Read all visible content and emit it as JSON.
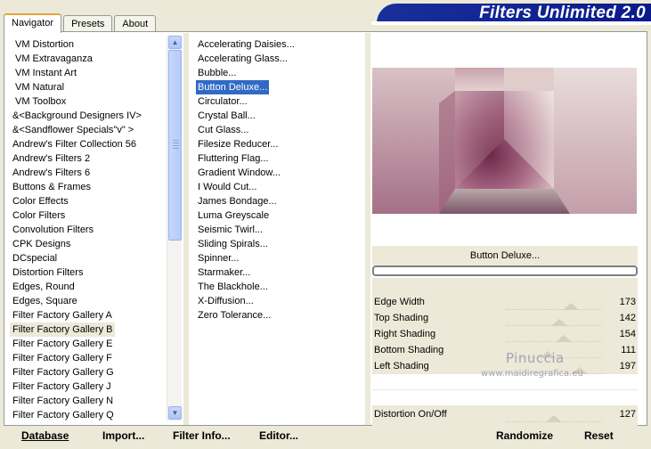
{
  "tabs": [
    "Navigator",
    "Presets",
    "About"
  ],
  "brand_title": "Filters Unlimited 2.0",
  "categories": [
    "VM Distortion",
    "VM Extravaganza",
    "VM Instant Art",
    "VM Natural",
    "VM Toolbox",
    "&<Background Designers IV>",
    "&<Sandflower Specials\"v\" >",
    "Andrew's Filter Collection 56",
    "Andrew's Filters 2",
    "Andrew's Filters 6",
    "Buttons & Frames",
    "Color Effects",
    "Color Filters",
    "Convolution Filters",
    "CPK Designs",
    "DCspecial",
    "Distortion Filters",
    "Edges, Round",
    "Edges, Square",
    "Filter Factory Gallery A",
    "Filter Factory Gallery B",
    "Filter Factory Gallery E",
    "Filter Factory Gallery F",
    "Filter Factory Gallery G",
    "Filter Factory Gallery J",
    "Filter Factory Gallery N",
    "Filter Factory Gallery Q"
  ],
  "selected_category": "Filter Factory Gallery B",
  "filters": [
    "Accelerating Daisies...",
    "Accelerating Glass...",
    "Bubble...",
    "Button Deluxe...",
    "Circulator...",
    "Crystal Ball...",
    "Cut Glass...",
    "Filesize Reducer...",
    "Fluttering Flag...",
    "Gradient Window...",
    "I Would Cut...",
    "James Bondage...",
    "Luma Greyscale",
    "Seismic Twirl...",
    "Sliding Spirals...",
    "Spinner...",
    "Starmaker...",
    "The Blackhole...",
    "X-Diffusion...",
    "Zero Tolerance..."
  ],
  "selected_filter": "Button Deluxe...",
  "filter_name": "Button Deluxe...",
  "progress": 0,
  "sliders": [
    {
      "label": "Edge Width",
      "value": "173",
      "max": 255
    },
    {
      "label": "Top Shading",
      "value": "142",
      "max": 255
    },
    {
      "label": "Right Shading",
      "value": "154",
      "max": 255
    },
    {
      "label": "Bottom Shading",
      "value": "111",
      "max": 255
    },
    {
      "label": "Left Shading",
      "value": "197",
      "max": 255
    },
    {
      "label": "Distortion On/Off",
      "value": "127",
      "max": 255
    }
  ],
  "buttons": {
    "database": "Database",
    "import": "Import...",
    "filter_info": "Filter Info...",
    "editor": "Editor...",
    "randomize": "Randomize",
    "reset": "Reset"
  },
  "watermark": {
    "name": "Pinuccia",
    "site": "www.maidiregrafica.eu"
  },
  "colors": {
    "selection": "#316ac5",
    "brand_bg": "#1a2f9a",
    "preview_mauve": "#a05a78",
    "preview_light": "#e3d3d0"
  }
}
